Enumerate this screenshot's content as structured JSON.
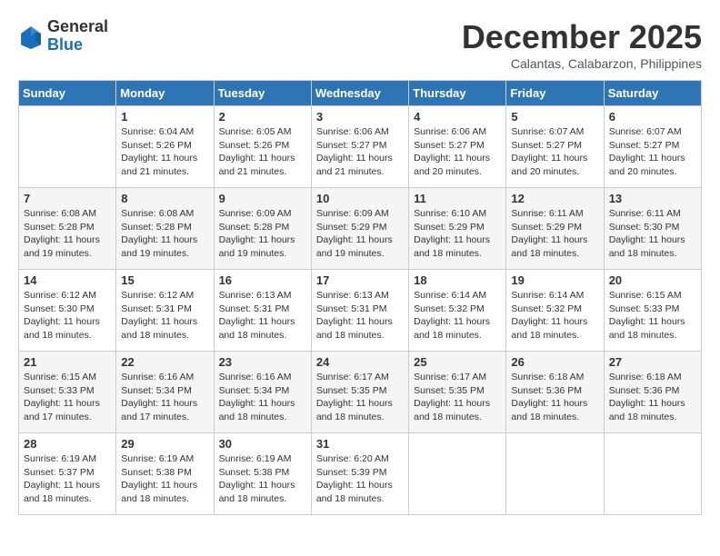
{
  "header": {
    "logo": {
      "general": "General",
      "blue": "Blue"
    },
    "title": "December 2025",
    "location": "Calantas, Calabarzon, Philippines"
  },
  "days_of_week": [
    "Sunday",
    "Monday",
    "Tuesday",
    "Wednesday",
    "Thursday",
    "Friday",
    "Saturday"
  ],
  "weeks": [
    [
      {
        "day": "",
        "info": ""
      },
      {
        "day": "1",
        "info": "Sunrise: 6:04 AM\nSunset: 5:26 PM\nDaylight: 11 hours\nand 21 minutes."
      },
      {
        "day": "2",
        "info": "Sunrise: 6:05 AM\nSunset: 5:26 PM\nDaylight: 11 hours\nand 21 minutes."
      },
      {
        "day": "3",
        "info": "Sunrise: 6:06 AM\nSunset: 5:27 PM\nDaylight: 11 hours\nand 21 minutes."
      },
      {
        "day": "4",
        "info": "Sunrise: 6:06 AM\nSunset: 5:27 PM\nDaylight: 11 hours\nand 20 minutes."
      },
      {
        "day": "5",
        "info": "Sunrise: 6:07 AM\nSunset: 5:27 PM\nDaylight: 11 hours\nand 20 minutes."
      },
      {
        "day": "6",
        "info": "Sunrise: 6:07 AM\nSunset: 5:27 PM\nDaylight: 11 hours\nand 20 minutes."
      }
    ],
    [
      {
        "day": "7",
        "info": "Sunrise: 6:08 AM\nSunset: 5:28 PM\nDaylight: 11 hours\nand 19 minutes."
      },
      {
        "day": "8",
        "info": "Sunrise: 6:08 AM\nSunset: 5:28 PM\nDaylight: 11 hours\nand 19 minutes."
      },
      {
        "day": "9",
        "info": "Sunrise: 6:09 AM\nSunset: 5:28 PM\nDaylight: 11 hours\nand 19 minutes."
      },
      {
        "day": "10",
        "info": "Sunrise: 6:09 AM\nSunset: 5:29 PM\nDaylight: 11 hours\nand 19 minutes."
      },
      {
        "day": "11",
        "info": "Sunrise: 6:10 AM\nSunset: 5:29 PM\nDaylight: 11 hours\nand 18 minutes."
      },
      {
        "day": "12",
        "info": "Sunrise: 6:11 AM\nSunset: 5:29 PM\nDaylight: 11 hours\nand 18 minutes."
      },
      {
        "day": "13",
        "info": "Sunrise: 6:11 AM\nSunset: 5:30 PM\nDaylight: 11 hours\nand 18 minutes."
      }
    ],
    [
      {
        "day": "14",
        "info": "Sunrise: 6:12 AM\nSunset: 5:30 PM\nDaylight: 11 hours\nand 18 minutes."
      },
      {
        "day": "15",
        "info": "Sunrise: 6:12 AM\nSunset: 5:31 PM\nDaylight: 11 hours\nand 18 minutes."
      },
      {
        "day": "16",
        "info": "Sunrise: 6:13 AM\nSunset: 5:31 PM\nDaylight: 11 hours\nand 18 minutes."
      },
      {
        "day": "17",
        "info": "Sunrise: 6:13 AM\nSunset: 5:31 PM\nDaylight: 11 hours\nand 18 minutes."
      },
      {
        "day": "18",
        "info": "Sunrise: 6:14 AM\nSunset: 5:32 PM\nDaylight: 11 hours\nand 18 minutes."
      },
      {
        "day": "19",
        "info": "Sunrise: 6:14 AM\nSunset: 5:32 PM\nDaylight: 11 hours\nand 18 minutes."
      },
      {
        "day": "20",
        "info": "Sunrise: 6:15 AM\nSunset: 5:33 PM\nDaylight: 11 hours\nand 18 minutes."
      }
    ],
    [
      {
        "day": "21",
        "info": "Sunrise: 6:15 AM\nSunset: 5:33 PM\nDaylight: 11 hours\nand 17 minutes."
      },
      {
        "day": "22",
        "info": "Sunrise: 6:16 AM\nSunset: 5:34 PM\nDaylight: 11 hours\nand 17 minutes."
      },
      {
        "day": "23",
        "info": "Sunrise: 6:16 AM\nSunset: 5:34 PM\nDaylight: 11 hours\nand 18 minutes."
      },
      {
        "day": "24",
        "info": "Sunrise: 6:17 AM\nSunset: 5:35 PM\nDaylight: 11 hours\nand 18 minutes."
      },
      {
        "day": "25",
        "info": "Sunrise: 6:17 AM\nSunset: 5:35 PM\nDaylight: 11 hours\nand 18 minutes."
      },
      {
        "day": "26",
        "info": "Sunrise: 6:18 AM\nSunset: 5:36 PM\nDaylight: 11 hours\nand 18 minutes."
      },
      {
        "day": "27",
        "info": "Sunrise: 6:18 AM\nSunset: 5:36 PM\nDaylight: 11 hours\nand 18 minutes."
      }
    ],
    [
      {
        "day": "28",
        "info": "Sunrise: 6:19 AM\nSunset: 5:37 PM\nDaylight: 11 hours\nand 18 minutes."
      },
      {
        "day": "29",
        "info": "Sunrise: 6:19 AM\nSunset: 5:38 PM\nDaylight: 11 hours\nand 18 minutes."
      },
      {
        "day": "30",
        "info": "Sunrise: 6:19 AM\nSunset: 5:38 PM\nDaylight: 11 hours\nand 18 minutes."
      },
      {
        "day": "31",
        "info": "Sunrise: 6:20 AM\nSunset: 5:39 PM\nDaylight: 11 hours\nand 18 minutes."
      },
      {
        "day": "",
        "info": ""
      },
      {
        "day": "",
        "info": ""
      },
      {
        "day": "",
        "info": ""
      }
    ]
  ]
}
